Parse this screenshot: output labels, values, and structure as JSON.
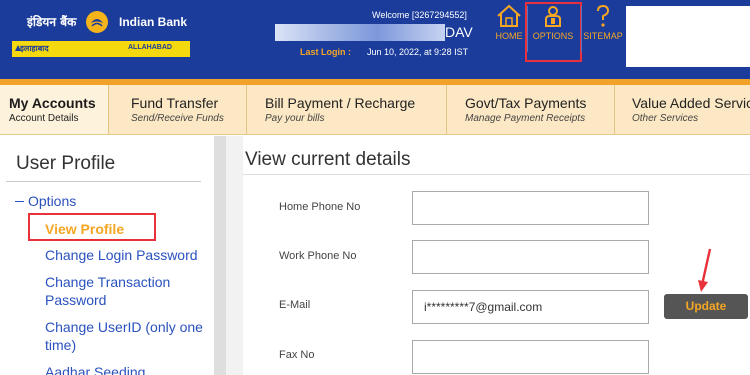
{
  "brand": {
    "name_hindi": "इंडियन बैंक",
    "name_english": "Indian Bank",
    "merger_hindi": "इलाहाबाद",
    "merger_english": "ALLAHABAD",
    "colors": {
      "header": "#1b3c9b",
      "accent": "#f5a623",
      "nav": "#fce8c4",
      "highlight": "#e8313a"
    }
  },
  "header": {
    "welcome": "Welcome [3267294552]",
    "user_name": "DAV",
    "last_login_label": "Last Login :",
    "last_login_value": "Jun 10, 2022, at 9:28 IST",
    "icons": [
      {
        "label": "HOME",
        "icon": "home-icon"
      },
      {
        "label": "OPTIONS",
        "icon": "user-options-icon"
      },
      {
        "label": "SITEMAP",
        "icon": "question-icon"
      }
    ]
  },
  "nav": {
    "tabs": [
      {
        "title": "My Accounts",
        "subtitle": "Account Details"
      },
      {
        "title": "Fund Transfer",
        "subtitle": "Send/Receive Funds"
      },
      {
        "title": "Bill Payment / Recharge",
        "subtitle": "Pay your bills"
      },
      {
        "title": "Govt/Tax Payments",
        "subtitle": "Manage Payment Receipts"
      },
      {
        "title": "Value Added Servic",
        "subtitle": "Other Services"
      }
    ]
  },
  "sidebar": {
    "title": "User Profile",
    "group": "Options",
    "items": [
      {
        "label": "View Profile"
      },
      {
        "label": "Change Login Password"
      },
      {
        "label": "Change Transaction Password"
      },
      {
        "label": "Change UserID (only one time)"
      },
      {
        "label": "Aadhar Seeding"
      }
    ]
  },
  "main": {
    "title": "View current details",
    "fields": [
      {
        "label": "Home Phone No",
        "value": ""
      },
      {
        "label": "Work Phone No",
        "value": ""
      },
      {
        "label": "E-Mail",
        "value": "i*********7@gmail.com"
      },
      {
        "label": "Fax No",
        "value": ""
      }
    ],
    "update_label": "Update"
  }
}
